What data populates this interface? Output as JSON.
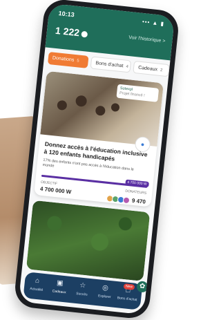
{
  "status": {
    "time": "10:13",
    "icons": "••• ▲ ▮"
  },
  "header": {
    "points": "1 222",
    "history_link": "Voir l'historique >"
  },
  "tabs": [
    {
      "label": "Donations",
      "count": "5"
    },
    {
      "label": "Bons d'achat",
      "count": "4"
    },
    {
      "label": "Cadeaux",
      "count": "2"
    }
  ],
  "card": {
    "tag_line1": "Sotexpl",
    "tag_line2": "Projet financé !",
    "title": "Donnez accès à l'éducation inclusive à 120 enfants handicapés",
    "description": "17% des enfants n'ont pas accès à l'éducation dans le monde",
    "progress_flag": "4 700 000 W",
    "progress_fraction": 1.0,
    "objective_label": "OBJECTIF",
    "objective_value": "4 700 000 W",
    "donors_label": "DONATEURS",
    "donors_count": "9 470"
  },
  "nav": [
    {
      "label": "Actualité",
      "icon": "home-icon"
    },
    {
      "label": "Cadeaux",
      "icon": "gift-icon"
    },
    {
      "label": "Succès",
      "icon": "trophy-icon"
    },
    {
      "label": "Explorer",
      "icon": "compass-icon"
    },
    {
      "label": "Bons d'achat",
      "icon": "voucher-icon",
      "badge": "New"
    }
  ],
  "colors": {
    "primary": "#1f6e5a",
    "accent": "#f07b34",
    "progress": "#5a2fa3",
    "navbar": "#1c3f63"
  }
}
